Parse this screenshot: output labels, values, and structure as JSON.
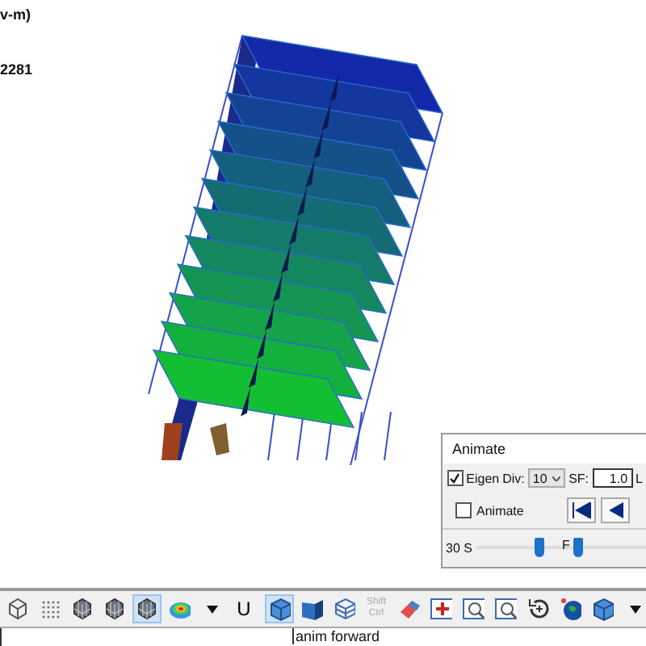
{
  "legend": {
    "unit_line": "v-m)",
    "value_line": "2281"
  },
  "animate_dialog": {
    "title": "Animate",
    "eigen": {
      "label": "Eigen",
      "checked": true
    },
    "div_label": "Div:",
    "div_value": "10",
    "sf_label": "SF:",
    "sf_value": "1.0",
    "cut_label": "L",
    "animate": {
      "label": "Animate",
      "checked": false
    },
    "speed_slow": "30 S",
    "speed_fast": "F",
    "thumbs": [
      {
        "level": 0.33
      },
      {
        "level": 0.54
      }
    ]
  },
  "toolbar": [
    {
      "kind": "wire-cube",
      "selected": false
    },
    {
      "kind": "dots",
      "selected": false
    },
    {
      "kind": "mesh",
      "selected": false
    },
    {
      "kind": "mesh",
      "selected": false
    },
    {
      "kind": "mesh",
      "selected": true
    },
    {
      "kind": "contour",
      "selected": false
    },
    {
      "kind": "dropdown",
      "selected": false
    },
    {
      "kind": "letter",
      "label": "U",
      "selected": false
    },
    {
      "kind": "separator"
    },
    {
      "kind": "solid-cube",
      "selected": true
    },
    {
      "kind": "solid-box",
      "selected": false
    },
    {
      "kind": "wire-box",
      "selected": false
    },
    {
      "kind": "keys",
      "label": "Shift",
      "label2": "Ctrl",
      "disabled": true,
      "selected": false
    },
    {
      "kind": "eraser",
      "selected": false
    },
    {
      "kind": "plus",
      "selected": false
    },
    {
      "kind": "zoom",
      "selected": false
    },
    {
      "kind": "zoom",
      "selected": false
    },
    {
      "kind": "rotate",
      "selected": false
    },
    {
      "kind": "globe",
      "selected": false
    },
    {
      "kind": "solid-cube",
      "selected": false
    },
    {
      "kind": "dropdown",
      "selected": false
    }
  ],
  "status": "anim forward"
}
